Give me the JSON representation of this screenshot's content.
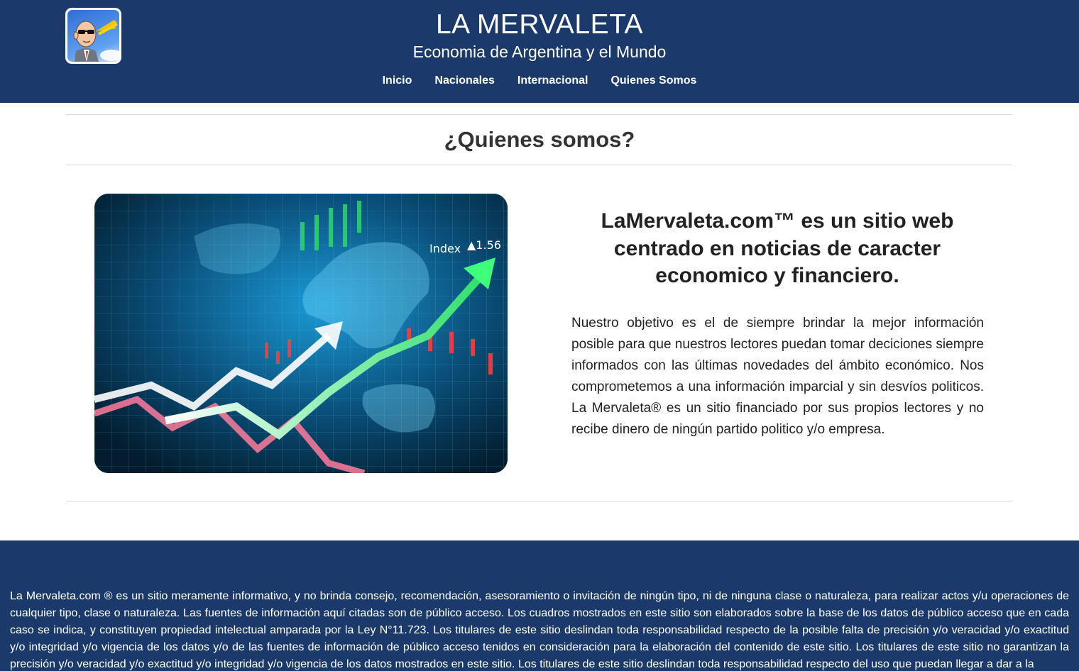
{
  "header": {
    "logo_icon": "cartoon-man-sunglasses-logo",
    "title": "LA MERVALETA",
    "subtitle": "Economia de Argentina y el Mundo",
    "nav": [
      {
        "label": "Inicio"
      },
      {
        "label": "Nacionales"
      },
      {
        "label": "Internacional"
      },
      {
        "label": "Quienes Somos"
      }
    ],
    "background_color": "#1b3a6b"
  },
  "main": {
    "section_title": "¿Quienes somos?",
    "hero_image": {
      "icon": "stock-market-world-map-image",
      "index_label": "Index",
      "index_value": "▲1.56"
    },
    "heading": "LaMervaleta.com™ es un sitio web centrado en noticias de caracter economico y financiero.",
    "body": "Nuestro objetivo es el de siempre brindar la mejor información posible para que nuestros lectores puedan tomar deciciones siempre informados con las últimas novedades del ámbito económico. Nos comprometemos a una información imparcial y sin desvíos politicos. La Mervaleta® es un sitio financiado por sus propios lectores y no recibe dinero de ningún partido politico y/o empresa."
  },
  "footer": {
    "disclaimer": "La Mervaleta.com ® es un sitio meramente informativo, y no brinda consejo, recomendación, asesoramiento o invitación de ningún tipo, ni de ninguna clase o naturaleza, para realizar actos y/u operaciones de cualquier tipo, clase o naturaleza. Las fuentes de información aquí citadas son de público acceso. Los cuadros mostrados en este sitio son elaborados sobre la base de los datos de público acceso que en cada caso se indica, y constituyen propiedad intelectual amparada por la Ley N°11.723. Los titulares de este sitio deslindan toda responsabilidad respecto de la posible falta de precisión y/o veracidad y/o exactitud y/o integridad y/o vigencia de los datos y/o de las fuentes de información de público acceso tenidos en consideración para la elaboración del contenido de este sitio. Los titulares de este sitio no garantizan la precisión y/o veracidad y/o exactitud y/o integridad y/o vigencia de los datos mostrados en este sitio. Los titulares de este sitio deslindan toda responsabilidad respecto del uso que puedan llegar a dar a la",
    "background_color": "#1b3a6b"
  }
}
